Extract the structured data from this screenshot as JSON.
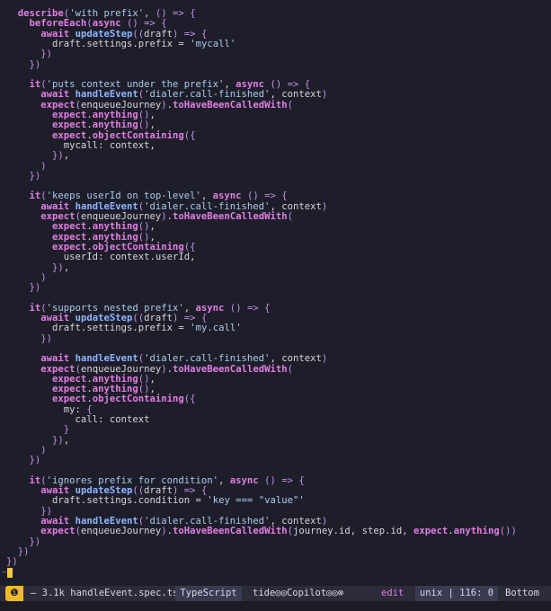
{
  "editor": {
    "code_lines": [
      "  describe('with prefix', () => {",
      "    beforeEach(async () => {",
      "      await updateStep((draft) => {",
      "        draft.settings.prefix = 'mycall'",
      "      })",
      "    })",
      "",
      "    it('puts context under the prefix', async () => {",
      "      await handleEvent('dialer.call-finished', context)",
      "      expect(enqueueJourney).toHaveBeenCalledWith(",
      "        expect.anything(),",
      "        expect.anything(),",
      "        expect.objectContaining({",
      "          mycall: context,",
      "        }),",
      "      )",
      "    })",
      "",
      "    it('keeps userId on top-level', async () => {",
      "      await handleEvent('dialer.call-finished', context)",
      "      expect(enqueueJourney).toHaveBeenCalledWith(",
      "        expect.anything(),",
      "        expect.anything(),",
      "        expect.objectContaining({",
      "          userId: context.userId,",
      "        }),",
      "      )",
      "    })",
      "",
      "    it('supports nested prefix', async () => {",
      "      await updateStep((draft) => {",
      "        draft.settings.prefix = 'my.call'",
      "      })",
      "",
      "      await handleEvent('dialer.call-finished', context)",
      "      expect(enqueueJourney).toHaveBeenCalledWith(",
      "        expect.anything(),",
      "        expect.anything(),",
      "        expect.objectContaining({",
      "          my: {",
      "            call: context",
      "          }",
      "        }),",
      "      )",
      "    })",
      "",
      "    it('ignores prefix for condition', async () => {",
      "      await updateStep((draft) => {",
      "        draft.settings.condition = 'key === \"value\"'",
      "      })",
      "      await handleEvent('dialer.call-finished', context)",
      "      expect(enqueueJourney).toHaveBeenCalledWith(journey.id, step.id, expect.anything())",
      "    })",
      "  })",
      "})"
    ],
    "tilde": "~"
  },
  "statusline": {
    "mode_icon": "❶",
    "file": "– 3.1k handleEvent.spec.ts",
    "language": "TypeScript",
    "plugins": "tide◎◎Copilot◎◎⊗",
    "edit_mode": "edit",
    "format_position": "unix | 116: 0",
    "scroll_position": "Bottom"
  },
  "colors": {
    "background": "#1e1e2a",
    "keyword": "#e27ee3",
    "function": "#8fb4ff",
    "string": "#a8cbea",
    "cursor": "#f6c945",
    "mode_accent": "#f1b82e"
  }
}
